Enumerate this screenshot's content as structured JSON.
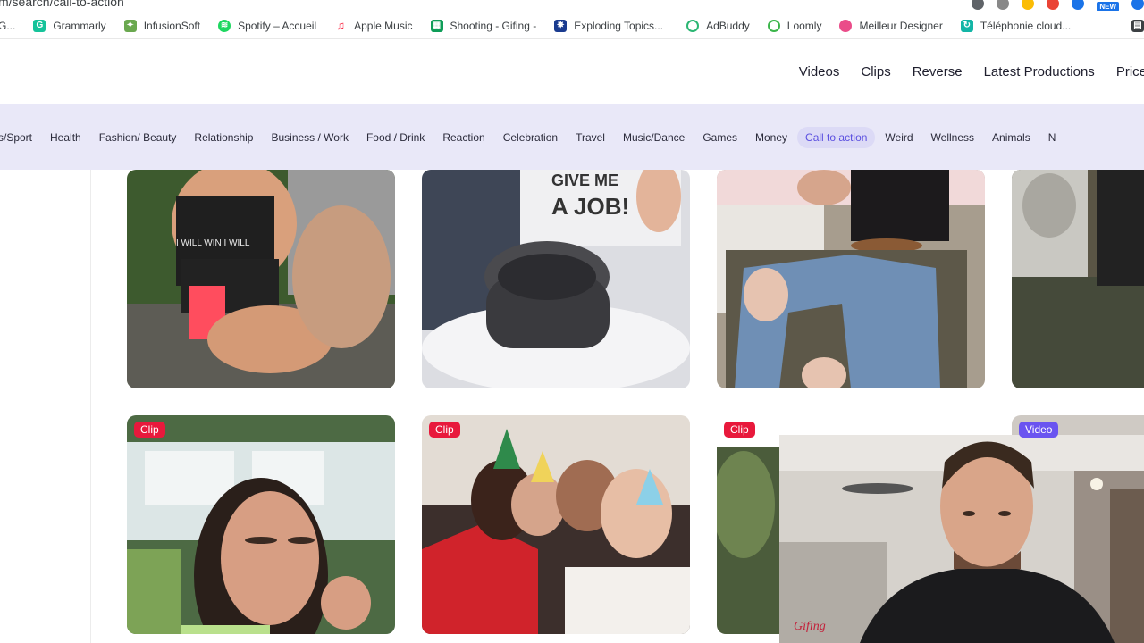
{
  "browser": {
    "url_text": "m/search/call-to-action",
    "new_badge": "NEW",
    "bookmarks": [
      {
        "label": "G...",
        "icon": "generic-icon",
        "color": "#5f6368"
      },
      {
        "label": "Grammarly",
        "icon": "grammarly-icon",
        "color": "#15c39a"
      },
      {
        "label": "InfusionSoft",
        "icon": "infusionsoft-icon",
        "color": "#6aa84f"
      },
      {
        "label": "Spotify – Accueil",
        "icon": "spotify-icon",
        "color": "#1ed760"
      },
      {
        "label": "Apple Music",
        "icon": "apple-music-icon",
        "color": "#fa2d48"
      },
      {
        "label": "Shooting - Gifing -",
        "icon": "sheets-icon",
        "color": "#0f9d58"
      },
      {
        "label": "Exploding Topics...",
        "icon": "exploding-topics-icon",
        "color": "#1a3b8f"
      },
      {
        "label": "AdBuddy",
        "icon": "adbuddy-icon",
        "color": "#2bb673"
      },
      {
        "label": "Loomly",
        "icon": "loomly-icon",
        "color": "#3bb54a"
      },
      {
        "label": "Meilleur Designer",
        "icon": "dribbble-icon",
        "color": "#ea4c89"
      },
      {
        "label": "Téléphonie cloud...",
        "icon": "cloud-phone-icon",
        "color": "#13b5a6"
      }
    ]
  },
  "header": {
    "nav": [
      "Videos",
      "Clips",
      "Reverse",
      "Latest Productions",
      "Price"
    ]
  },
  "categories": {
    "items": [
      "s/Sport",
      "Health",
      "Fashion/ Beauty",
      "Relationship",
      "Business / Work",
      "Food / Drink",
      "Reaction",
      "Celebration",
      "Travel",
      "Music/Dance",
      "Games",
      "Money",
      "Call to action",
      "Weird",
      "Wellness",
      "Animals",
      "N"
    ],
    "active": "Call to action"
  },
  "cards": {
    "row2_badges": [
      "Clip",
      "Clip",
      "Clip",
      "Video"
    ],
    "row1_sign_text": "A JOB!",
    "row1_sign_top_text": "GIVE ME",
    "shirt_text": "I WILL WIN  I WILL"
  },
  "webcam": {
    "watermark": "Gifing"
  }
}
